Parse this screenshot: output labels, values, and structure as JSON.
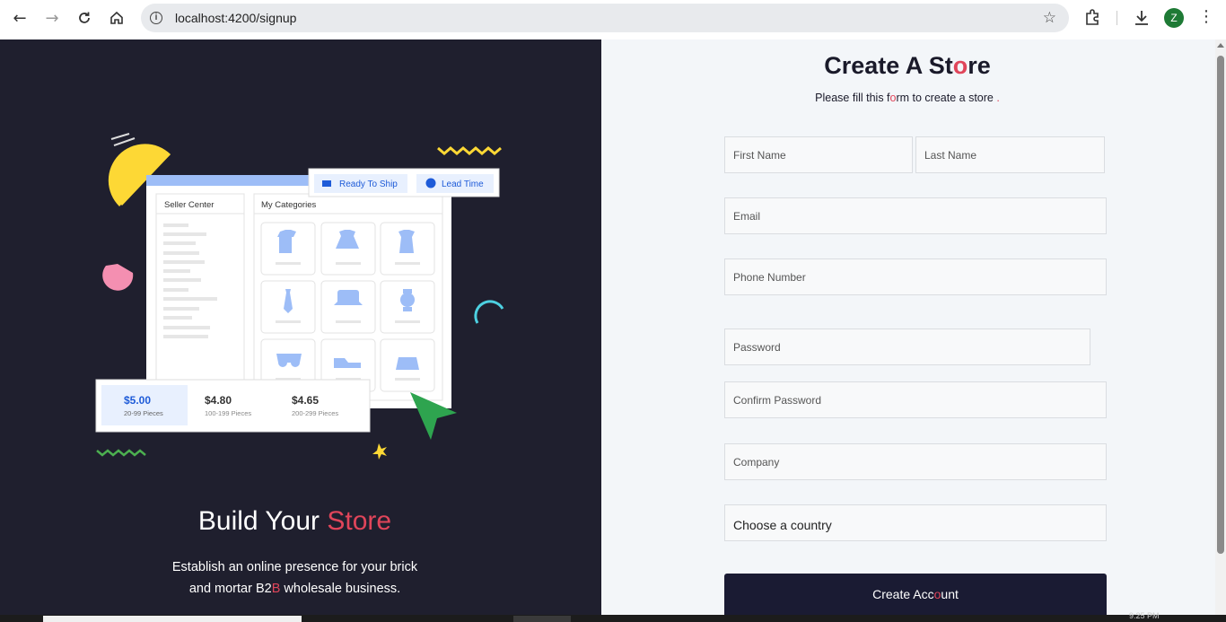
{
  "browser": {
    "url": "localhost:4200/signup",
    "avatar_letter": "Z"
  },
  "hero": {
    "title_main": "Build Your ",
    "title_accent": "Store",
    "desc_line1": "Establish an online presence for your brick",
    "desc_line2_a": "and mortar B2",
    "desc_line2_b": "B",
    "desc_line2_c": " wholesale business."
  },
  "illustration": {
    "seller_center": "Seller Center",
    "my_categories": "My Categories",
    "ready_to_ship": "Ready To Ship",
    "lead_time": "Lead Time",
    "prices": [
      {
        "price": "$5.00",
        "range": "20-99 Pieces"
      },
      {
        "price": "$4.80",
        "range": "100-199 Pieces"
      },
      {
        "price": "$4.65",
        "range": "200-299 Pieces"
      }
    ]
  },
  "form": {
    "title_a": "Create A St",
    "title_o": "o",
    "title_b": "re",
    "sub_a": "Please fill this f",
    "sub_o": "o",
    "sub_b": "rm to create a store",
    "first_name": "First Name",
    "last_name": "Last Name",
    "email": "Email",
    "phone": "Phone Number",
    "password": "Password",
    "confirm_password": "Confirm Password",
    "company": "Company",
    "country": "Choose a country",
    "button_a": "Create Acc",
    "button_o": "o",
    "button_b": "unt"
  },
  "taskbar": {
    "clock": "9:25 PM"
  }
}
